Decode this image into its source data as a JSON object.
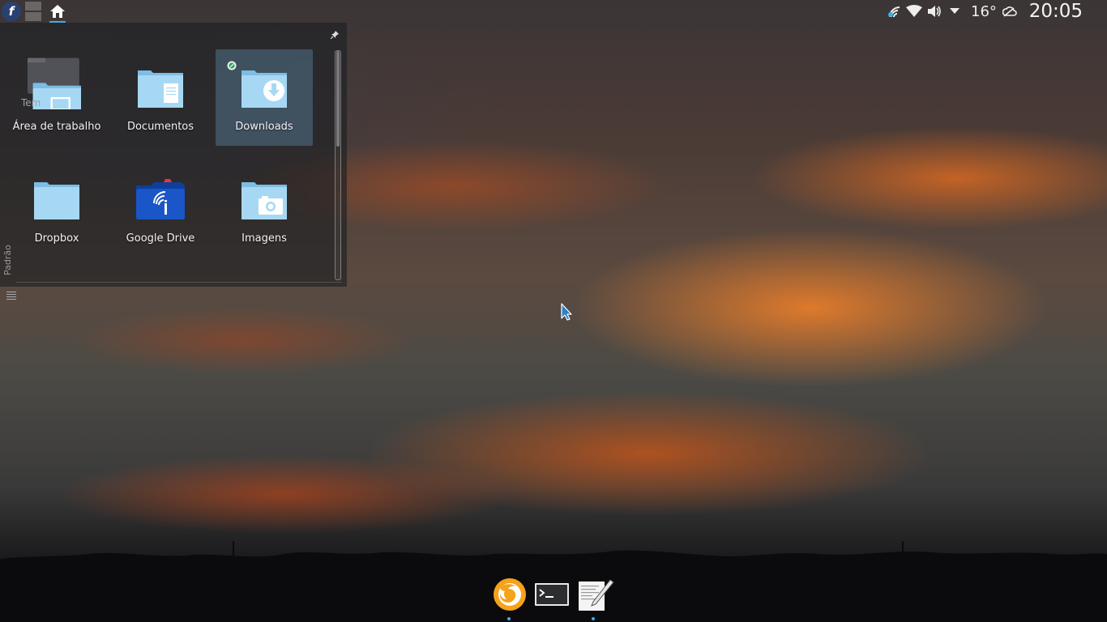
{
  "top_panel": {
    "launcher_glyph": "f",
    "weather_temp": "16°",
    "clock": "20:05"
  },
  "folder_view": {
    "side_label": "Padrão",
    "items": [
      {
        "label": "Área de trabalho",
        "icon": "desktop-folder-icon",
        "overlay_text": "Tem",
        "selected": false
      },
      {
        "label": "Documentos",
        "icon": "documents-folder-icon",
        "selected": false
      },
      {
        "label": "Downloads",
        "icon": "downloads-folder-icon",
        "selected": true
      },
      {
        "label": "Dropbox",
        "icon": "dropbox-folder-icon",
        "selected": false
      },
      {
        "label": "Google Drive",
        "icon": "google-drive-folder-icon",
        "selected": false
      },
      {
        "label": "Imagens",
        "icon": "pictures-folder-icon",
        "selected": false
      }
    ]
  },
  "dock": {
    "items": [
      {
        "name": "firefox",
        "icon": "firefox-icon",
        "running": true
      },
      {
        "name": "terminal",
        "icon": "terminal-icon",
        "running": false
      },
      {
        "name": "text-editor",
        "icon": "text-editor-icon",
        "running": true
      }
    ]
  },
  "colors": {
    "accent": "#3daee9",
    "folder_light": "#a7d8f3",
    "folder_dark": "#7cbde6",
    "google_drive_blue": "#1a56c8",
    "selection": "#5a82a0"
  }
}
